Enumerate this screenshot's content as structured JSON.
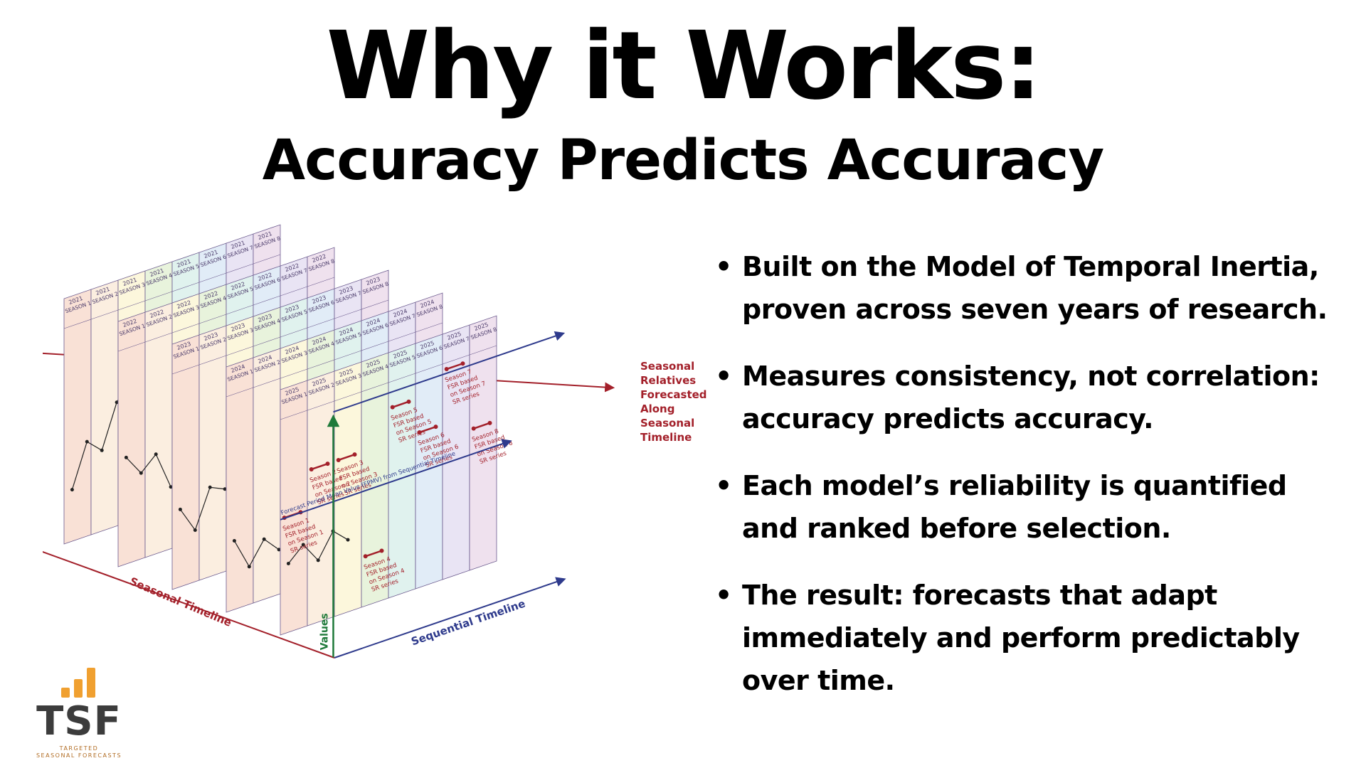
{
  "title": "Why it Works:",
  "subtitle": "Accuracy Predicts Accuracy",
  "bullets": [
    {
      "line1": "Built on the Model of Temporal Inertia,",
      "line2": "proven across seven years of research.",
      "line3": ""
    },
    {
      "line1": "Measures consistency, not correlation:",
      "line2": "accuracy predicts accuracy.",
      "line3": ""
    },
    {
      "line1": "Each model’s reliability is quantified",
      "line2": "and ranked before selection.",
      "line3": ""
    },
    {
      "line1": "The result: forecasts that adapt",
      "line2": "immediately and perform predictably",
      "line3": "over time."
    }
  ],
  "diagram": {
    "years": [
      "2021",
      "2022",
      "2023",
      "2024",
      "2025"
    ],
    "seasons": [
      "SEASON 1",
      "SEASON 2",
      "SEASON 3",
      "SEASON 4",
      "SEASON 5",
      "SEASON 6",
      "SEASON 7",
      "SEASON 8"
    ],
    "season_colors": [
      "#f9e1d6",
      "#fbeee0",
      "#fcf7dc",
      "#e8f3dc",
      "#e0f2ee",
      "#e1ecf7",
      "#e9e4f4",
      "#efe1ee"
    ],
    "seasonal_relatives_label": [
      "Seasonal",
      "Relatives",
      "Forecasted",
      "Along",
      "Seasonal",
      "Timeline"
    ],
    "fpmv_label": "Forecast Period Mean Value (FPMV) from Sequential Timeline",
    "values_label": "Values",
    "seasonal_timeline_label": "Seasonal Timeline",
    "sequential_timeline_label": "Sequential Timeline",
    "fsr_notes": [
      {
        "season": 1,
        "lines": [
          "Season 1",
          "FSR based",
          "on Season 1",
          "SR series"
        ]
      },
      {
        "season": 2,
        "lines": [
          "Season 2",
          "FSR based",
          "on Season 2",
          "SR series"
        ]
      },
      {
        "season": 3,
        "lines": [
          "Season 3",
          "FSR based",
          "on Season 3",
          "SR series"
        ]
      },
      {
        "season": 4,
        "lines": [
          "Season 4",
          "FSR based",
          "on Season 4",
          "SR series"
        ]
      },
      {
        "season": 5,
        "lines": [
          "Season 5",
          "FSR based",
          "on Season 5",
          "SR series"
        ]
      },
      {
        "season": 6,
        "lines": [
          "Season 6",
          "FSR based",
          "on Season 6",
          "SR series"
        ]
      },
      {
        "season": 7,
        "lines": [
          "Season 7",
          "FSR based",
          "on Season 7",
          "SR series"
        ]
      },
      {
        "season": 8,
        "lines": [
          "Season 8",
          "FSR based",
          "on Season 8",
          "SR series"
        ]
      }
    ],
    "colors": {
      "red_axis": "#a3202a",
      "blue_axis": "#2e3a8c",
      "green_axis": "#1f7a3a",
      "panel_border": "#6b5a8e"
    }
  },
  "logo": {
    "text": "TSF",
    "tagline_1": "TARGETED",
    "tagline_2": "SEASONAL FORECASTS",
    "accent": "#f0a030"
  }
}
